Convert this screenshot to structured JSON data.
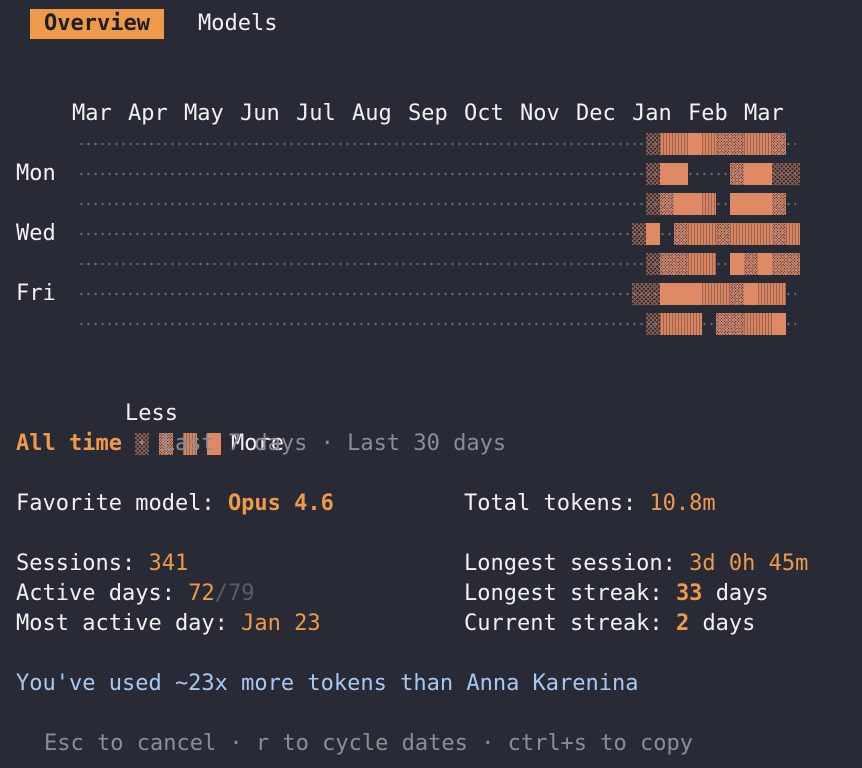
{
  "tabs": [
    {
      "label": "Overview",
      "active": true
    },
    {
      "label": "Models",
      "active": false
    }
  ],
  "heatmap": {
    "months": [
      "Mar",
      "Apr",
      "May",
      "Jun",
      "Jul",
      "Aug",
      "Sep",
      "Oct",
      "Nov",
      "Dec",
      "Jan",
      "Feb",
      "Mar"
    ],
    "day_labels": [
      "Mon",
      "Wed",
      "Fri"
    ],
    "legend": {
      "less": "Less",
      "more": "More"
    },
    "accent_color": "#e08a65"
  },
  "range": {
    "options": [
      "All time",
      "Last 7 days",
      "Last 30 days"
    ],
    "selected": "All time",
    "separator": "·"
  },
  "stats": {
    "favorite_model_label": "Favorite model:",
    "favorite_model": "Opus 4.6",
    "total_tokens_label": "Total tokens:",
    "total_tokens": "10.8m",
    "sessions_label": "Sessions:",
    "sessions": "341",
    "longest_session_label": "Longest session:",
    "longest_session": "3d 0h 45m",
    "active_days_label": "Active days:",
    "active_days": "72",
    "active_days_total": "/79",
    "longest_streak_label": "Longest streak:",
    "longest_streak": "33",
    "days_unit": "days",
    "most_active_label": "Most active day:",
    "most_active_day": "Jan 23",
    "current_streak_label": "Current streak:",
    "current_streak": "2"
  },
  "fun_fact": "You've used ~23x more tokens than Anna Karenina",
  "footer": "Esc to cancel · r to cycle dates · ctrl+s to copy",
  "colors": {
    "background": "#282a36",
    "accent": "#ee9a49",
    "link": "#a9c8f0",
    "dim": "#8b8d96"
  }
}
